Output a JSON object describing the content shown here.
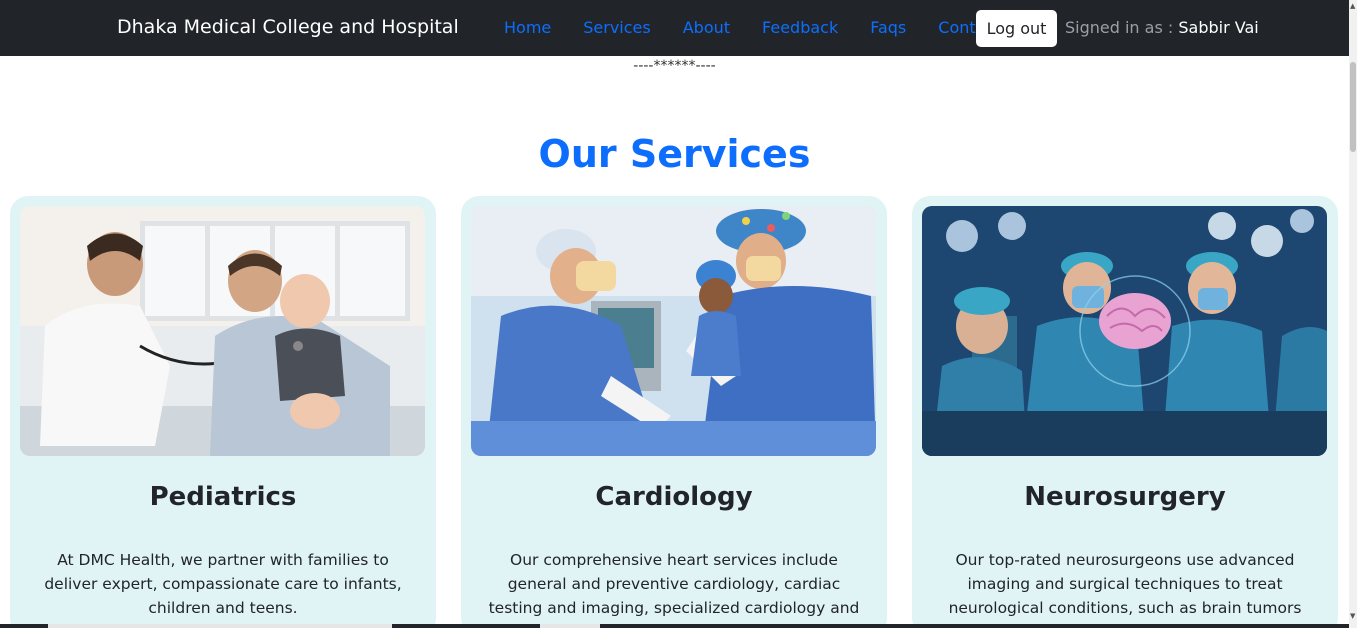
{
  "navbar": {
    "brand": "Dhaka Medical College and Hospital",
    "links": [
      "Home",
      "Services",
      "About",
      "Feedback",
      "Faqs",
      "Contact"
    ],
    "logout_label": "Log out",
    "signed_in_prefix": "Signed in as :",
    "user_name": "Sabbir Vai"
  },
  "divider_text": "----******----",
  "section_title": "Our Services",
  "services": [
    {
      "title": "Pediatrics",
      "text": "At DMC Health, we partner with families to deliver expert, compassionate care to infants, children and teens.",
      "image_icon": "pediatrician-examining-baby-image"
    },
    {
      "title": "Cardiology",
      "text": "Our comprehensive heart services include general and preventive cardiology, cardiac testing and imaging, specialized cardiology and cardiac surgery.",
      "image_icon": "cardiac-surgery-team-image"
    },
    {
      "title": "Neurosurgery",
      "text": "Our top-rated neurosurgeons use advanced imaging and surgical techniques to treat neurological conditions, such as brain tumors and traumatic brain injuries.",
      "image_icon": "neurosurgery-operating-room-image"
    }
  ],
  "colors": {
    "navbar_bg": "#212529",
    "link": "#0d6efd",
    "card_bg": "#e0f4f6",
    "title": "#0d6efd"
  }
}
